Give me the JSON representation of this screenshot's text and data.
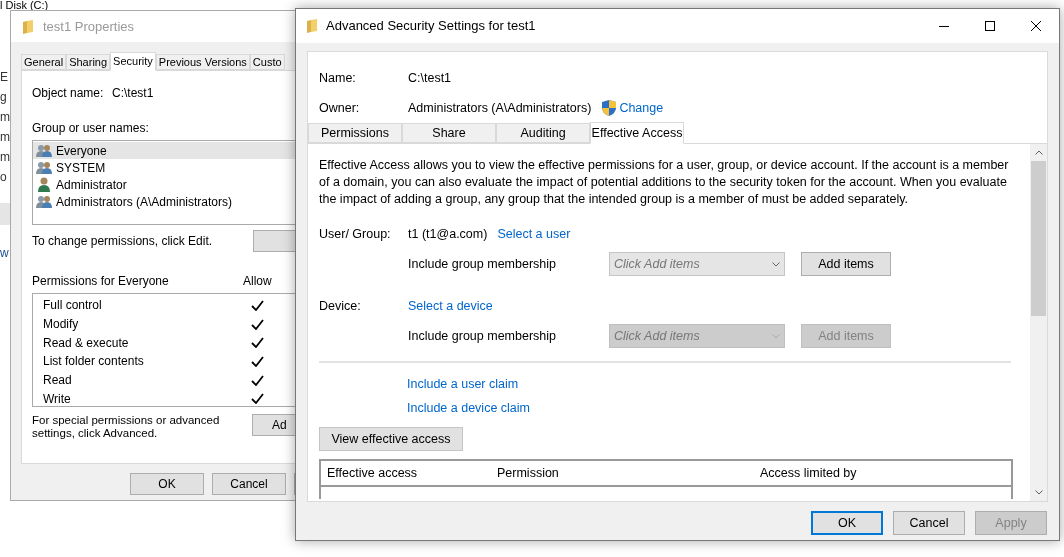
{
  "explorer_background": {
    "title": "l Disk (C:)",
    "fragments": [
      {
        "text": "E"
      },
      {
        "text": "g"
      },
      {
        "text": "m"
      },
      {
        "text": "m"
      },
      {
        "text": "m"
      },
      {
        "text": "o"
      }
    ],
    "selected_row": true,
    "last_fragment": "w"
  },
  "properties_window": {
    "title": "test1 Properties",
    "tabs": [
      {
        "label": "General",
        "selected": false
      },
      {
        "label": "Sharing",
        "selected": false
      },
      {
        "label": "Security",
        "selected": true
      },
      {
        "label": "Previous Versions",
        "selected": false
      },
      {
        "label": "Custo",
        "selected": false
      }
    ],
    "object_name_label": "Object name:",
    "object_name": "C:\\test1",
    "group_label": "Group or user names:",
    "principals": [
      {
        "name": "Everyone",
        "kind": "group",
        "selected": true
      },
      {
        "name": "SYSTEM",
        "kind": "group",
        "selected": false
      },
      {
        "name": "Administrator",
        "kind": "user",
        "selected": false
      },
      {
        "name": "Administrators (A\\Administrators)",
        "kind": "group",
        "selected": false
      }
    ],
    "change_hint": "To change permissions, click Edit.",
    "permissions_label": "Permissions for Everyone",
    "allow_header": "Allow",
    "permissions": [
      {
        "name": "Full control",
        "allow": true
      },
      {
        "name": "Modify",
        "allow": true
      },
      {
        "name": "Read & execute",
        "allow": true
      },
      {
        "name": "List folder contents",
        "allow": true
      },
      {
        "name": "Read",
        "allow": true
      },
      {
        "name": "Write",
        "allow": true
      }
    ],
    "advanced_hint": "For special permissions or advanced settings, click Advanced.",
    "advanced_button": "Ad",
    "buttons": [
      "OK",
      "Cancel"
    ]
  },
  "advanced_window": {
    "title": "Advanced Security Settings for test1",
    "name_label": "Name:",
    "name": "C:\\test1",
    "owner_label": "Owner:",
    "owner": "Administrators (A\\Administrators)",
    "change_link": "Change",
    "tabs": [
      {
        "label": "Permissions",
        "selected": false
      },
      {
        "label": "Share",
        "selected": false
      },
      {
        "label": "Auditing",
        "selected": false
      },
      {
        "label": "Effective Access",
        "selected": true
      }
    ],
    "description": "Effective Access allows you to view the effective permissions for a user, group, or device account. If the account is a member of a domain, you can also evaluate the impact of potential additions to the security token for the account. When you evaluate the impact of adding a group, any group that the intended group is a member of must be added separately.",
    "sections": [
      {
        "label": "User/ Group:",
        "value": "t1 (t1@a.com)",
        "link": "Select a user",
        "include_label": "Include group membership",
        "dropdown_placeholder": "Click Add items",
        "add_button": "Add items",
        "disabled": false
      },
      {
        "label": "Device:",
        "link": "Select a device",
        "include_label": "Include group membership",
        "dropdown_placeholder": "Click Add items",
        "add_button": "Add items",
        "disabled": true
      }
    ],
    "claim_links": [
      "Include a user claim",
      "Include a device claim"
    ],
    "view_button": "View effective access",
    "table_columns": [
      "Effective access",
      "Permission",
      "Access limited by"
    ],
    "buttons": [
      {
        "label": "OK",
        "default": true,
        "disabled": false
      },
      {
        "label": "Cancel",
        "default": false,
        "disabled": false
      },
      {
        "label": "Apply",
        "default": false,
        "disabled": true
      }
    ]
  }
}
